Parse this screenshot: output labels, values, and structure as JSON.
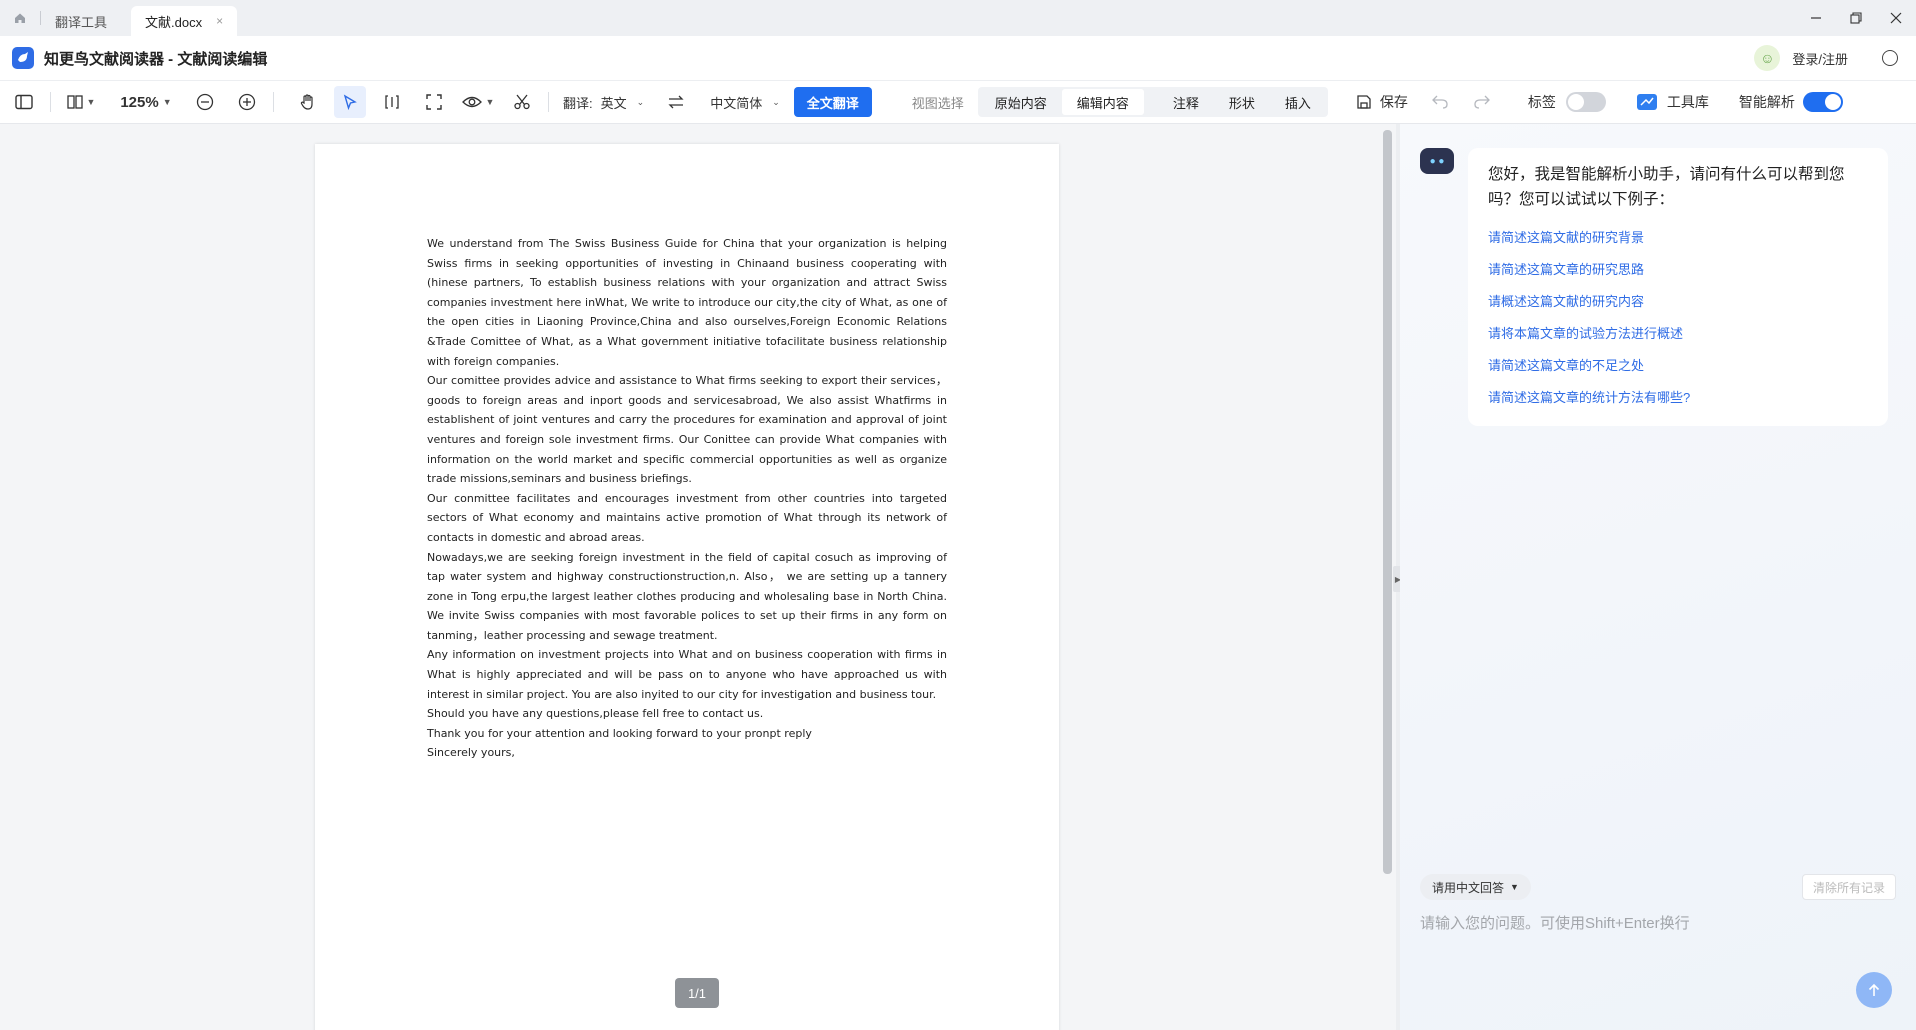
{
  "titlebar": {
    "home_icon": "home-icon",
    "tabs": [
      {
        "label": "翻译工具"
      },
      {
        "label": "文献.docx"
      }
    ],
    "close_tab_glyph": "×",
    "window_controls": [
      "minimize-icon",
      "restore-icon",
      "close-icon"
    ]
  },
  "header": {
    "app_title": "知更鸟文献阅读器 - 文献阅读编辑",
    "login_label": "登录/注册"
  },
  "toolbar": {
    "zoom": "125%",
    "translate_label": "翻译:",
    "source_lang": "英文",
    "target_lang": "中文简体",
    "full_translate": "全文翻译",
    "view_select": "视图选择",
    "view_modes": [
      {
        "label": "原始内容",
        "selected": false
      },
      {
        "label": "编辑内容",
        "selected": true
      }
    ],
    "tools": [
      "注释",
      "形状",
      "插入"
    ],
    "save_label": "保存",
    "tag_label": "标签",
    "tag_enabled": false,
    "toolbox_label": "工具库",
    "smart_parse_label": "智能解析",
    "smart_parse_enabled": true
  },
  "document": {
    "paragraphs": [
      "We understand from The Swiss Business Guide for China that your organization is helping Swiss firms in seeking opportunities of investing in Chinaand business cooperating with (hinese partners, To establish business relations with your organization and attract Swiss companies investment here inWhat, We write to introduce our city,the city of What, as one of the open cities in Liaoning Province,China and also ourselves,Foreign Economic Relations &Trade Comittee of What, as a What government initiative tofacilitate business relationship with foreign companies.",
      "Our comittee provides advice and assistance to What firms seeking to export their services，goods to foreign areas and inport goods and servicesabroad, We also assist Whatfirms in establishent of joint ventures and carry the procedures for examination and approval of joint ventures and foreign sole investment firms. Our Conittee can provide What companies with information on the world market and specific commercial opportunities as well as organize trade missions,seminars and business briefings.",
      "Our conmittee facilitates and encourages investment from other countries into targeted sectors of What economy and maintains active promotion of What through its network of contacts in domestic and abroad areas.",
      "Nowadays,we are seeking foreign investment in the field of capital cosuch as improving of tap water system and highway constructionstruction,n. Also， we are setting up a tannery zone in Tong erpu,the largest leather clothes producing and wholesaling base in North China. We invite Swiss companies with most favorable polices to set up their firms in any form on tanming，leather processing and sewage treatment.",
      "Any information on investment projects into What and on business cooperation with firms in What is highly appreciated and will be pass on to anyone who have approached us with interest in similar project. You are also inyited to our city for investigation and business tour.",
      "Should you have any questions,please fell free to contact us.",
      "Thank you for your attention and looking forward to your pronpt reply",
      "Sincerely yours,"
    ],
    "page_indicator": "1/1"
  },
  "assistant": {
    "greeting": "您好，我是智能解析小助手，请问有什么可以帮到您吗？您可以试试以下例子：",
    "suggestions": [
      "请简述这篇文献的研究背景",
      "请简述这篇文章的研究思路",
      "请概述这篇文献的研究内容",
      "请将本篇文章的试验方法进行概述",
      "请简述这篇文章的不足之处",
      "请简述这篇文章的统计方法有哪些?"
    ],
    "language_option": "请用中文回答",
    "clear_label": "清除所有记录",
    "input_placeholder": "请输入您的问题。可使用Shift+Enter换行"
  },
  "colors": {
    "accent": "#1f6ef0",
    "link": "#2f6ce5",
    "page_indicator_bg": "#8e9297"
  }
}
